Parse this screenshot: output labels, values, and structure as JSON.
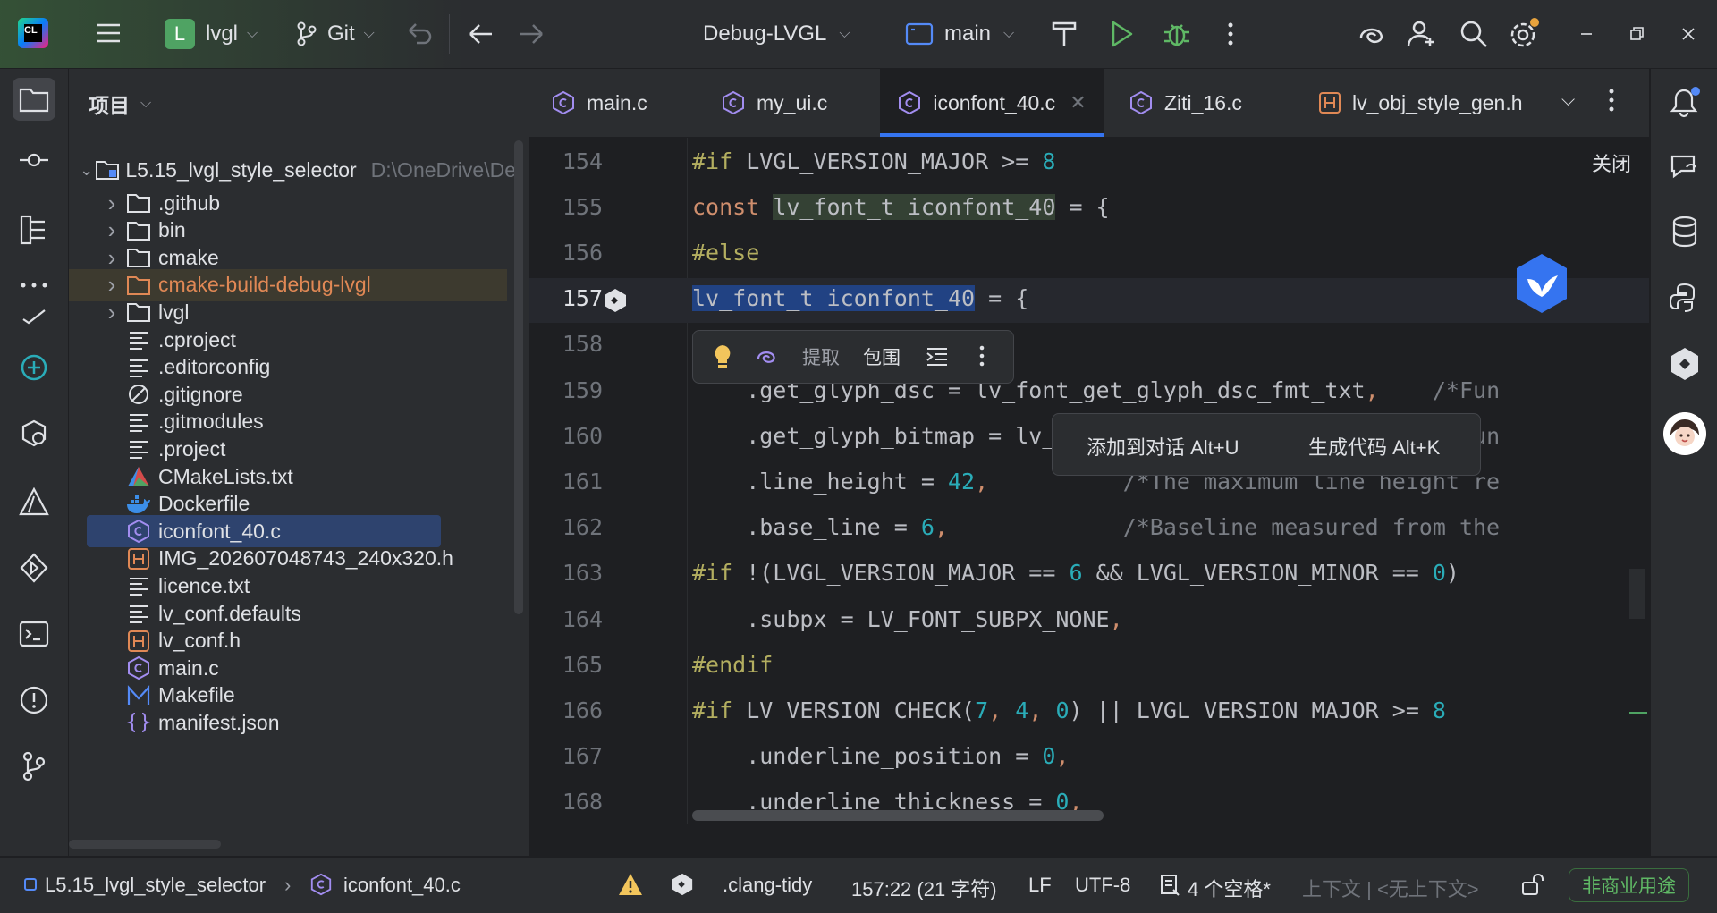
{
  "titlebar": {
    "project_badge": "L",
    "project_name": "lvgl",
    "vcs": "Git",
    "run_config": "Debug-LVGL",
    "target": "main"
  },
  "project_panel": {
    "title": "项目",
    "root_name": "L5.15_lvgl_style_selector",
    "root_path": "D:\\OneDrive\\De",
    "items": [
      {
        "label": ".github",
        "type": "folder"
      },
      {
        "label": "bin",
        "type": "folder"
      },
      {
        "label": "cmake",
        "type": "folder"
      },
      {
        "label": "cmake-build-debug-lvgl",
        "type": "folder-build"
      },
      {
        "label": "lvgl",
        "type": "folder"
      },
      {
        "label": ".cproject",
        "type": "text"
      },
      {
        "label": ".editorconfig",
        "type": "text"
      },
      {
        "label": ".gitignore",
        "type": "ignore"
      },
      {
        "label": ".gitmodules",
        "type": "text"
      },
      {
        "label": ".project",
        "type": "text"
      },
      {
        "label": "CMakeLists.txt",
        "type": "cmake"
      },
      {
        "label": "Dockerfile",
        "type": "docker"
      },
      {
        "label": "iconfont_40.c",
        "type": "c-source",
        "selected": true
      },
      {
        "label": "IMG_202607048743_240x320.h",
        "type": "header"
      },
      {
        "label": "licence.txt",
        "type": "text"
      },
      {
        "label": "lv_conf.defaults",
        "type": "text"
      },
      {
        "label": "lv_conf.h",
        "type": "header"
      },
      {
        "label": "main.c",
        "type": "c-source"
      },
      {
        "label": "Makefile",
        "type": "makefile"
      },
      {
        "label": "manifest.json",
        "type": "json"
      }
    ]
  },
  "tabs": [
    {
      "label": "main.c",
      "icon": "c-file-icon"
    },
    {
      "label": "my_ui.c",
      "icon": "c-file-icon"
    },
    {
      "label": "iconfont_40.c",
      "icon": "c-file-icon",
      "active": true
    },
    {
      "label": "Ziti_16.c",
      "icon": "c-file-icon"
    },
    {
      "label": "lv_obj_style_gen.h",
      "icon": "h-file-icon"
    }
  ],
  "editor": {
    "close_label": "关闭",
    "lines": [
      {
        "n": "154",
        "text": "#if LVGL_VERSION_MAJOR >= 8"
      },
      {
        "n": "155",
        "text": "const lv_font_t iconfont_40 = {"
      },
      {
        "n": "156",
        "text": "#else"
      },
      {
        "n": "157",
        "text": "lv_font_t iconfont_40 = {"
      },
      {
        "n": "158",
        "text": ""
      },
      {
        "n": "159",
        "text": "    .get_glyph_dsc = lv_font_get_glyph_dsc_fmt_txt,    /*Fun"
      },
      {
        "n": "160",
        "text": "    .get_glyph_bitmap = lv_font_get_bitmap_fmt_txt,    /*Fun"
      },
      {
        "n": "161",
        "text": "    .line_height = 42,          /*The maximum line height re"
      },
      {
        "n": "162",
        "text": "    .base_line = 6,             /*Baseline measured from the"
      },
      {
        "n": "163",
        "text": "#if !(LVGL_VERSION_MAJOR == 6 && LVGL_VERSION_MINOR == 0)"
      },
      {
        "n": "164",
        "text": "    .subpx = LV_FONT_SUBPX_NONE,"
      },
      {
        "n": "165",
        "text": "#endif"
      },
      {
        "n": "166",
        "text": "#if LV_VERSION_CHECK(7, 4, 0) || LVGL_VERSION_MAJOR >= 8"
      },
      {
        "n": "167",
        "text": "    .underline_position = 0,"
      },
      {
        "n": "168",
        "text": "    .underline_thickness = 0,"
      }
    ]
  },
  "quickbar": {
    "extract": "提取",
    "surround": "包围"
  },
  "ai_menu": {
    "add_to_chat": "添加到对话 Alt+U",
    "generate_code": "生成代码 Alt+K"
  },
  "statusbar": {
    "breadcrumb_project": "L5.15_lvgl_style_selector",
    "breadcrumb_file": "iconfont_40.c",
    "linter": ".clang-tidy",
    "position": "157:22 (21 字符)",
    "line_ending": "LF",
    "encoding": "UTF-8",
    "indent": "4 个空格*",
    "context": "上下文 | <无上下文>",
    "license": "非商业用途"
  },
  "colors": {
    "accent": "#3574f0",
    "selection": "#214283",
    "run_green": "#5fb865"
  }
}
